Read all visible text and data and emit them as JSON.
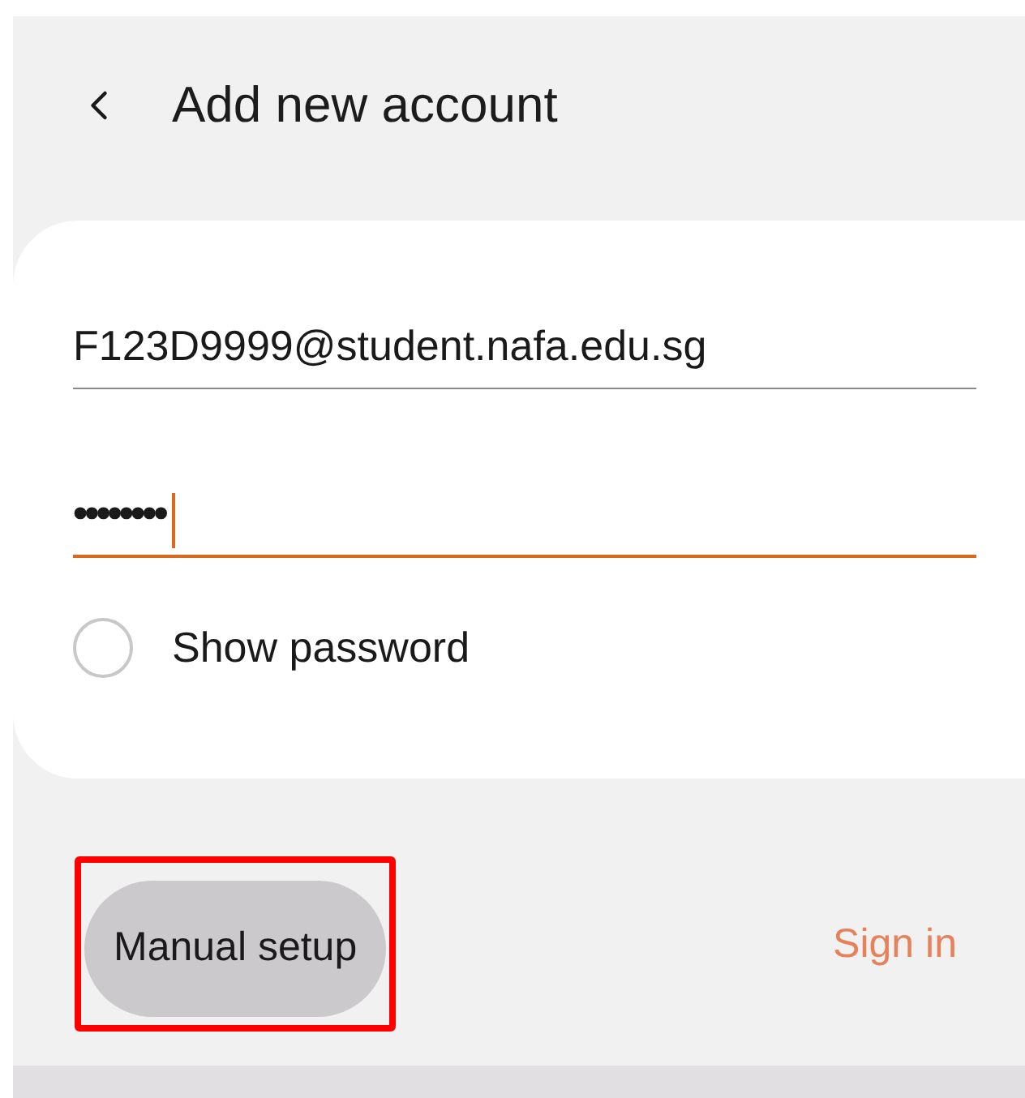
{
  "header": {
    "title": "Add new account"
  },
  "fields": [
    {
      "kind": "email",
      "value": "F123D9999@student.nafa.edu.sg",
      "focused": false
    },
    {
      "kind": "password",
      "value": "••••••••",
      "focused": true
    }
  ],
  "show_password": {
    "label": "Show password",
    "checked": false
  },
  "buttons": [
    {
      "label": "Manual setup",
      "kind": "secondary",
      "highlighted": true
    },
    {
      "label": "Sign in",
      "kind": "text",
      "highlighted": false
    }
  ]
}
